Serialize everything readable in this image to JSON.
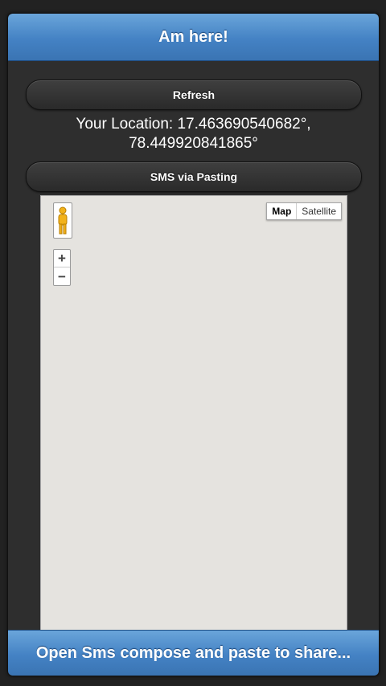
{
  "header": {
    "title": "Am here!"
  },
  "buttons": {
    "refresh_label": "Refresh",
    "sms_label": "SMS via Pasting"
  },
  "location": {
    "line1": "Your Location: 17.463690540682°,",
    "line2": "78.449920841865°"
  },
  "map": {
    "pegman_icon": "pegman-icon",
    "zoom_in": "+",
    "zoom_out": "−",
    "type_map": "Map",
    "type_satellite": "Satellite",
    "background_color": "#e5e3df"
  },
  "footer": {
    "label": "Open Sms compose and paste to share..."
  },
  "colors": {
    "accent_blue": "#4482c4",
    "panel_dark": "#2e2e2e"
  }
}
